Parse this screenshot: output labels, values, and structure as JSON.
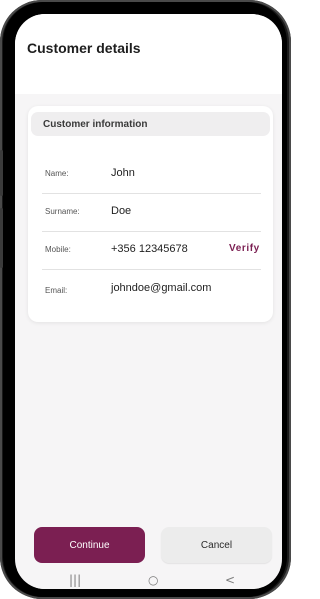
{
  "header": {
    "title": "Customer details"
  },
  "card": {
    "title": "Customer information",
    "fields": [
      {
        "label": "Name:",
        "value": "John"
      },
      {
        "label": "Surname:",
        "value": "Doe"
      },
      {
        "label": "Mobile:",
        "value": "+356 12345678",
        "action": "Verify"
      },
      {
        "label": "Email:",
        "value": "johndoe@gmail.com"
      }
    ]
  },
  "buttons": {
    "continue": "Continue",
    "cancel": "Cancel"
  },
  "navbar": {
    "recent_icon": "|||",
    "home_icon": "○",
    "back_icon": "<"
  },
  "colors": {
    "accent": "#7b1f52",
    "background": "#f6f5f6",
    "card": "#ffffff"
  },
  "icons": {
    "recent": "recent-apps-icon",
    "home": "home-icon",
    "back": "back-icon"
  }
}
